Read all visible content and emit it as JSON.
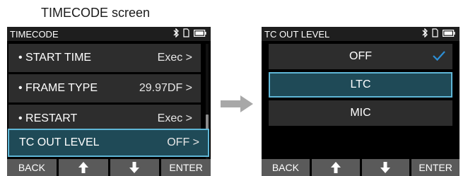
{
  "caption": "TIMECODE screen",
  "left_screen": {
    "title": "TIMECODE",
    "rows": [
      {
        "label": "• START TIME",
        "value": "Exec >"
      },
      {
        "label": "• FRAME TYPE",
        "value": "29.97DF >"
      },
      {
        "label": "• RESTART",
        "value": "Exec >"
      },
      {
        "label": "TC OUT LEVEL",
        "value": "OFF >"
      }
    ],
    "softkeys": [
      "BACK",
      "↑",
      "↓",
      "ENTER"
    ]
  },
  "right_screen": {
    "title": "TC OUT LEVEL",
    "options": [
      "OFF",
      "LTC",
      "MIC"
    ],
    "checked_option": "OFF",
    "selected_option": "LTC",
    "softkeys": [
      "BACK",
      "↑",
      "↓",
      "ENTER"
    ]
  },
  "colors": {
    "selected_fill": "#1f4a57",
    "selected_border": "#5fb6d6",
    "check": "#2d8fd6",
    "arrow": "#a8a8a8"
  },
  "icons": [
    "bluetooth-icon",
    "sd-card-icon",
    "battery-icon",
    "check-icon",
    "next-arrow-icon"
  ]
}
